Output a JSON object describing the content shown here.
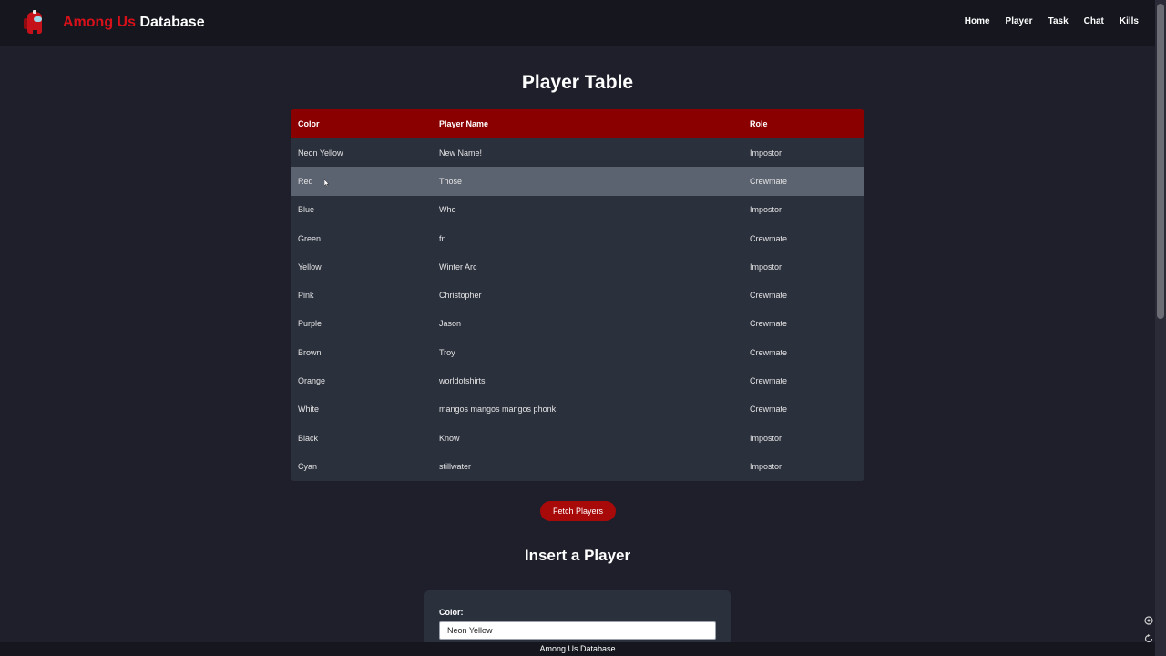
{
  "brand": {
    "accent": "Among Us",
    "rest": "Database"
  },
  "nav": [
    "Home",
    "Player",
    "Task",
    "Chat",
    "Kills"
  ],
  "page_title": "Player Table",
  "table": {
    "headers": [
      "Color",
      "Player Name",
      "Role"
    ],
    "rows": [
      [
        "Neon Yellow",
        "New Name!",
        "Impostor"
      ],
      [
        "Red",
        "Those",
        "Crewmate"
      ],
      [
        "Blue",
        "Who",
        "Impostor"
      ],
      [
        "Green",
        "fn",
        "Crewmate"
      ],
      [
        "Yellow",
        "Winter Arc",
        "Impostor"
      ],
      [
        "Pink",
        "Christopher",
        "Crewmate"
      ],
      [
        "Purple",
        "Jason",
        "Crewmate"
      ],
      [
        "Brown",
        "Troy",
        "Crewmate"
      ],
      [
        "Orange",
        "worldofshirts",
        "Crewmate"
      ],
      [
        "White",
        "mangos mangos mangos phonk",
        "Crewmate"
      ],
      [
        "Black",
        "Know",
        "Impostor"
      ],
      [
        "Cyan",
        "stillwater",
        "Impostor"
      ]
    ]
  },
  "fetch_button": "Fetch Players",
  "insert_title": "Insert a Player",
  "form": {
    "color_label": "Color:",
    "color_value": "Neon Yellow"
  },
  "footer": "Among Us Database",
  "colors": {
    "accent": "#d8101a",
    "header_row": "#8a0000",
    "background": "#1e1f2b"
  },
  "icons": [
    "crewmate-logo-icon",
    "mouse-cursor-icon",
    "settings-icon",
    "refresh-icon"
  ]
}
